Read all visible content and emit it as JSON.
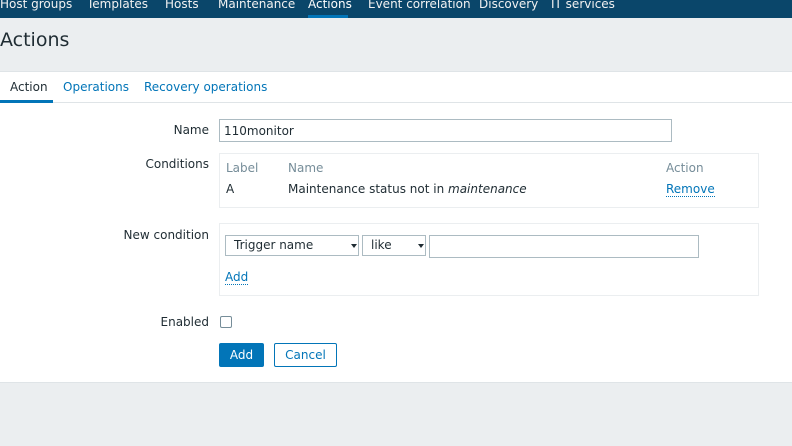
{
  "topnav": {
    "items": [
      "Host groups",
      "Templates",
      "Hosts",
      "Maintenance",
      "Actions",
      "Event correlation",
      "Discovery",
      "IT services"
    ],
    "active": "Actions"
  },
  "page": {
    "title": "Actions"
  },
  "tabs": {
    "items": [
      "Action",
      "Operations",
      "Recovery operations"
    ],
    "active": "Action"
  },
  "form": {
    "name_label": "Name",
    "name_value": "110monitor",
    "conditions_label": "Conditions",
    "conditions": {
      "headers": {
        "label": "Label",
        "name": "Name",
        "action": "Action"
      },
      "rows": [
        {
          "label": "A",
          "name_prefix": "Maintenance status not in ",
          "name_emphasis": "maintenance",
          "action": "Remove"
        }
      ]
    },
    "new_condition_label": "New condition",
    "new_condition": {
      "type_select": "Trigger name",
      "operator_select": "like",
      "value": "",
      "add_link": "Add"
    },
    "enabled_label": "Enabled",
    "enabled_checked": false,
    "add_button": "Add",
    "cancel_button": "Cancel"
  },
  "colors": {
    "nav_bg": "#0a466a",
    "accent": "#0275b8",
    "page_bg": "#ebeef0"
  }
}
